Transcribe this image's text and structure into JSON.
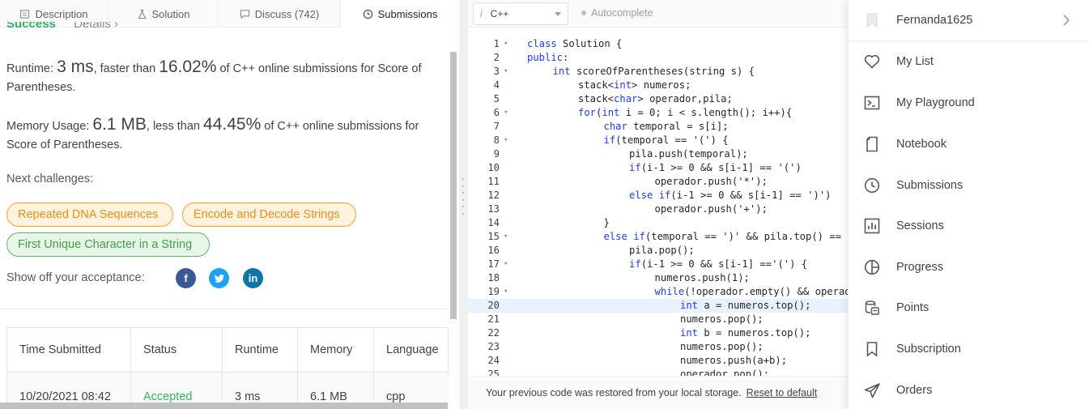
{
  "tabs": [
    {
      "label": "Description",
      "icon": "description-icon"
    },
    {
      "label": "Solution",
      "icon": "flask-icon"
    },
    {
      "label": "Discuss (742)",
      "icon": "discuss-icon"
    },
    {
      "label": "Submissions",
      "icon": "clock-icon"
    }
  ],
  "result": {
    "status": "Success",
    "details": "Details",
    "runtime_prefix": "Runtime: ",
    "runtime_value": "3 ms",
    "runtime_mid": ", faster than ",
    "runtime_pct": "16.02%",
    "runtime_suffix": " of C++ online submissions for Score of Parentheses.",
    "memory_prefix": "Memory Usage: ",
    "memory_value": "6.1 MB",
    "memory_mid": ", less than ",
    "memory_pct": "44.45%",
    "memory_suffix": " of C++ online submissions for Score of Parentheses."
  },
  "next_challenges": {
    "label": "Next challenges:",
    "items": [
      "Repeated DNA Sequences",
      "Encode and Decode Strings",
      "First Unique Character in a String"
    ]
  },
  "share": {
    "label": "Show off your acceptance:",
    "facebook": "f",
    "linkedin": "in"
  },
  "table": {
    "headers": [
      "Time Submitted",
      "Status",
      "Runtime",
      "Memory",
      "Language"
    ],
    "row": [
      "10/20/2021 08:42",
      "Accepted",
      "3 ms",
      "6.1 MB",
      "cpp"
    ]
  },
  "editor": {
    "language": "C++",
    "language_icon": "i",
    "autocomplete": "Autocomplete",
    "footer_text": "Your previous code was restored from your local storage.",
    "footer_link": "Reset to default",
    "lines": [
      {
        "n": "1",
        "fold": "▾",
        "indent": 0,
        "code": "class Solution {"
      },
      {
        "n": "2",
        "fold": "",
        "indent": 0,
        "code": "public:"
      },
      {
        "n": "3",
        "fold": "▾",
        "indent": 1,
        "code": "int scoreOfParentheses(string s) {"
      },
      {
        "n": "4",
        "fold": "",
        "indent": 2,
        "code": "stack<int> numeros;"
      },
      {
        "n": "5",
        "fold": "",
        "indent": 2,
        "code": "stack<char> operador,pila;"
      },
      {
        "n": "6",
        "fold": "▾",
        "indent": 2,
        "code": "for(int i = 0; i < s.length(); i++){"
      },
      {
        "n": "7",
        "fold": "",
        "indent": 3,
        "code": "char temporal = s[i];"
      },
      {
        "n": "8",
        "fold": "▾",
        "indent": 3,
        "code": "if(temporal == '(') {"
      },
      {
        "n": "9",
        "fold": "",
        "indent": 4,
        "code": "pila.push(temporal);"
      },
      {
        "n": "10",
        "fold": "",
        "indent": 4,
        "code": "if(i-1 >= 0 && s[i-1] == '(')"
      },
      {
        "n": "11",
        "fold": "",
        "indent": 5,
        "code": "operador.push('*');"
      },
      {
        "n": "12",
        "fold": "",
        "indent": 4,
        "code": "else if(i-1 >= 0 && s[i-1] == ')')"
      },
      {
        "n": "13",
        "fold": "",
        "indent": 5,
        "code": "operador.push('+');"
      },
      {
        "n": "14",
        "fold": "",
        "indent": 3,
        "code": "}"
      },
      {
        "n": "15",
        "fold": "▾",
        "indent": 3,
        "code": "else if(temporal == ')' && pila.top() =="
      },
      {
        "n": "16",
        "fold": "",
        "indent": 4,
        "code": "pila.pop();"
      },
      {
        "n": "17",
        "fold": "▾",
        "indent": 4,
        "code": "if(i-1 >= 0 && s[i-1] =='(') {"
      },
      {
        "n": "18",
        "fold": "",
        "indent": 5,
        "code": "numeros.push(1);"
      },
      {
        "n": "19",
        "fold": "▾",
        "indent": 5,
        "code": "while(!operador.empty() && operador"
      },
      {
        "n": "20",
        "fold": "",
        "indent": 6,
        "code": "int a = numeros.top();"
      },
      {
        "n": "21",
        "fold": "",
        "indent": 6,
        "code": "numeros.pop();"
      },
      {
        "n": "22",
        "fold": "",
        "indent": 6,
        "code": "int b = numeros.top();"
      },
      {
        "n": "23",
        "fold": "",
        "indent": 6,
        "code": "numeros.pop();"
      },
      {
        "n": "24",
        "fold": "",
        "indent": 6,
        "code": "numeros.push(a+b);"
      },
      {
        "n": "25",
        "fold": "",
        "indent": 6,
        "code": "operador.pop();"
      }
    ],
    "highlighted_line": "20"
  },
  "menu": {
    "username": "Fernanda1625",
    "items": [
      {
        "label": "My List",
        "icon": "heart-icon"
      },
      {
        "label": "My Playground",
        "icon": "terminal-icon"
      },
      {
        "label": "Notebook",
        "icon": "notebook-icon"
      },
      {
        "label": "Submissions",
        "icon": "clock-icon"
      },
      {
        "label": "Sessions",
        "icon": "chart-icon"
      },
      {
        "label": "Progress",
        "icon": "pie-icon"
      },
      {
        "label": "Points",
        "icon": "coins-icon"
      },
      {
        "label": "Subscription",
        "icon": "bookmark-icon"
      },
      {
        "label": "Orders",
        "icon": "send-icon"
      }
    ]
  },
  "colors": {
    "accent_orange": "#ffa116",
    "success_green": "#2db55d",
    "facebook": "#3b5998",
    "twitter": "#1da1f2",
    "linkedin": "#0e76a8"
  }
}
